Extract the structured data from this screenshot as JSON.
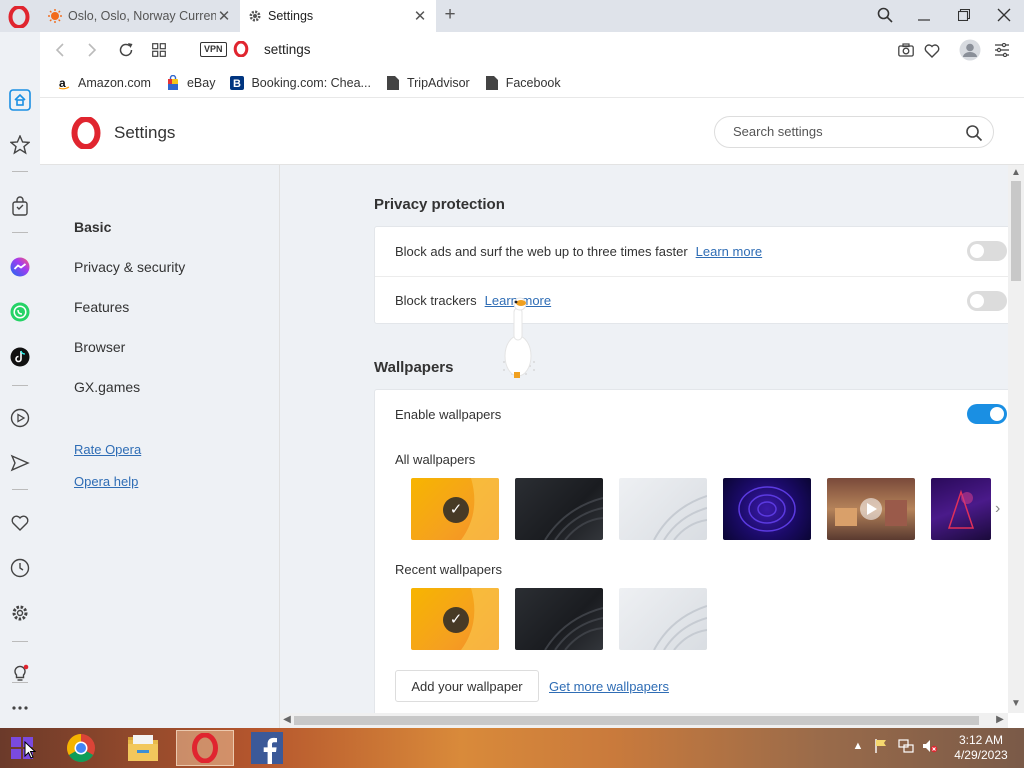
{
  "browser": {
    "tabs": [
      {
        "title": "Oslo, Oslo, Norway Current",
        "active": false
      },
      {
        "title": "Settings",
        "active": true
      }
    ],
    "address": {
      "vpn_label": "VPN",
      "url": "settings"
    },
    "bookmarks": [
      {
        "label": "Amazon.com",
        "icon": "amazon-icon"
      },
      {
        "label": "eBay",
        "icon": "ebay-icon"
      },
      {
        "label": "Booking.com: Chea...",
        "icon": "booking-icon"
      },
      {
        "label": "TripAdvisor",
        "icon": "page-icon"
      },
      {
        "label": "Facebook",
        "icon": "page-icon"
      }
    ]
  },
  "settings": {
    "title": "Settings",
    "search_placeholder": "Search settings",
    "nav": {
      "items": [
        "Basic",
        "Privacy & security",
        "Features",
        "Browser",
        "GX.games"
      ],
      "active": "Basic",
      "links": [
        "Rate Opera",
        "Opera help"
      ]
    },
    "privacy": {
      "title": "Privacy protection",
      "block_ads": {
        "label": "Block ads and surf the web up to three times faster",
        "link": "Learn more",
        "enabled": false
      },
      "block_trackers": {
        "label": "Block trackers",
        "link": "Learn more",
        "enabled": false
      }
    },
    "wallpapers": {
      "title": "Wallpapers",
      "enable_label": "Enable wallpapers",
      "enabled": true,
      "all_label": "All wallpapers",
      "recent_label": "Recent wallpapers",
      "add_button": "Add your wallpaper",
      "more_link": "Get more wallpapers"
    }
  },
  "taskbar": {
    "time": "3:12 AM",
    "date": "4/29/2023"
  },
  "colors": {
    "opera_red": "#e0252f",
    "link_blue": "#2f6db5",
    "toggle_on": "#1a8fe3"
  }
}
